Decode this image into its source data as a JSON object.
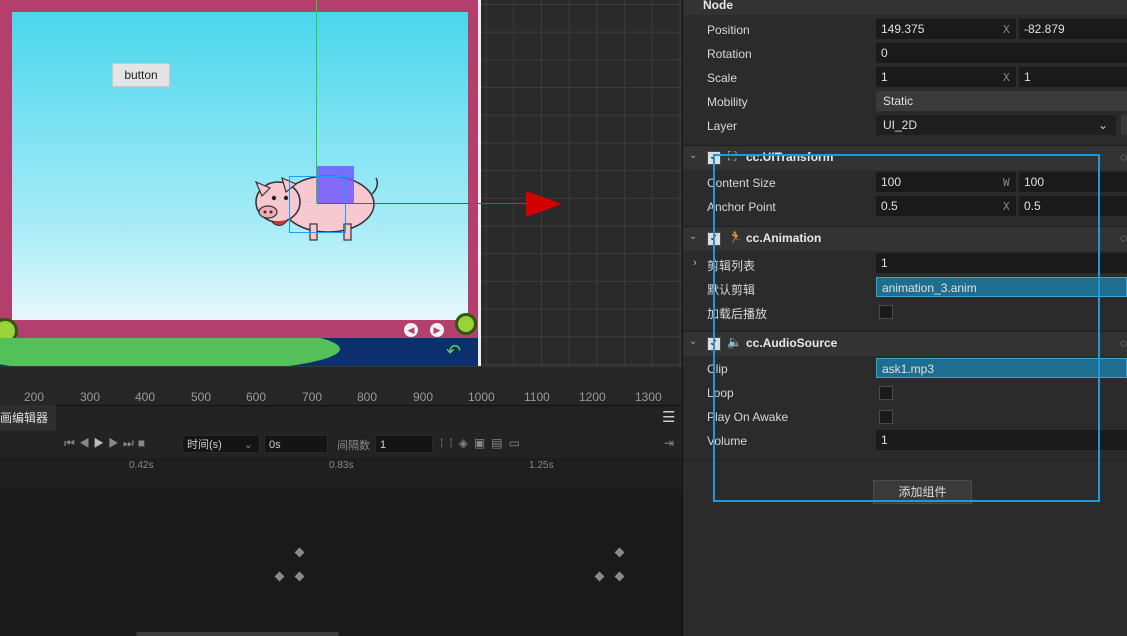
{
  "scene": {
    "button_label": "button",
    "ruler_ticks": [
      "200",
      "300",
      "400",
      "500",
      "600",
      "700",
      "800",
      "900",
      "1000",
      "1100",
      "1200",
      "1300"
    ]
  },
  "animation_editor": {
    "tab_label": "画编辑器",
    "time_label": "时间(s)",
    "time_value": "0s",
    "interval_label": "间隔数",
    "interval_value": "1",
    "timeline_ticks": [
      "0.42s",
      "0.83s",
      "1.25s"
    ]
  },
  "inspector": {
    "node_header": "Node",
    "position_label": "Position",
    "position_x": "149.375",
    "position_y": "-82.879",
    "rotation_label": "Rotation",
    "rotation_value": "0",
    "scale_label": "Scale",
    "scale_x": "1",
    "scale_y": "1",
    "mobility_label": "Mobility",
    "mobility_value": "Static",
    "layer_label": "Layer",
    "layer_value": "UI_2D",
    "axis_x": "X",
    "axis_w": "W",
    "uitransform_title": "cc.UITransform",
    "content_size_label": "Content Size",
    "content_w": "100",
    "content_h": "100",
    "anchor_label": "Anchor Point",
    "anchor_x": "0.5",
    "anchor_y": "0.5",
    "animation_title": "cc.Animation",
    "clip_list_label": "剪辑列表",
    "clip_list_value": "1",
    "default_clip_label": "默认剪辑",
    "default_clip_value": "animation_3.anim",
    "play_on_load_label": "加载后播放",
    "audiosource_title": "cc.AudioSource",
    "clip_label": "Clip",
    "clip_value": "ask1.mp3",
    "loop_label": "Loop",
    "play_on_awake_label": "Play On Awake",
    "volume_label": "Volume",
    "volume_value": "1",
    "add_component_label": "添加组件"
  }
}
